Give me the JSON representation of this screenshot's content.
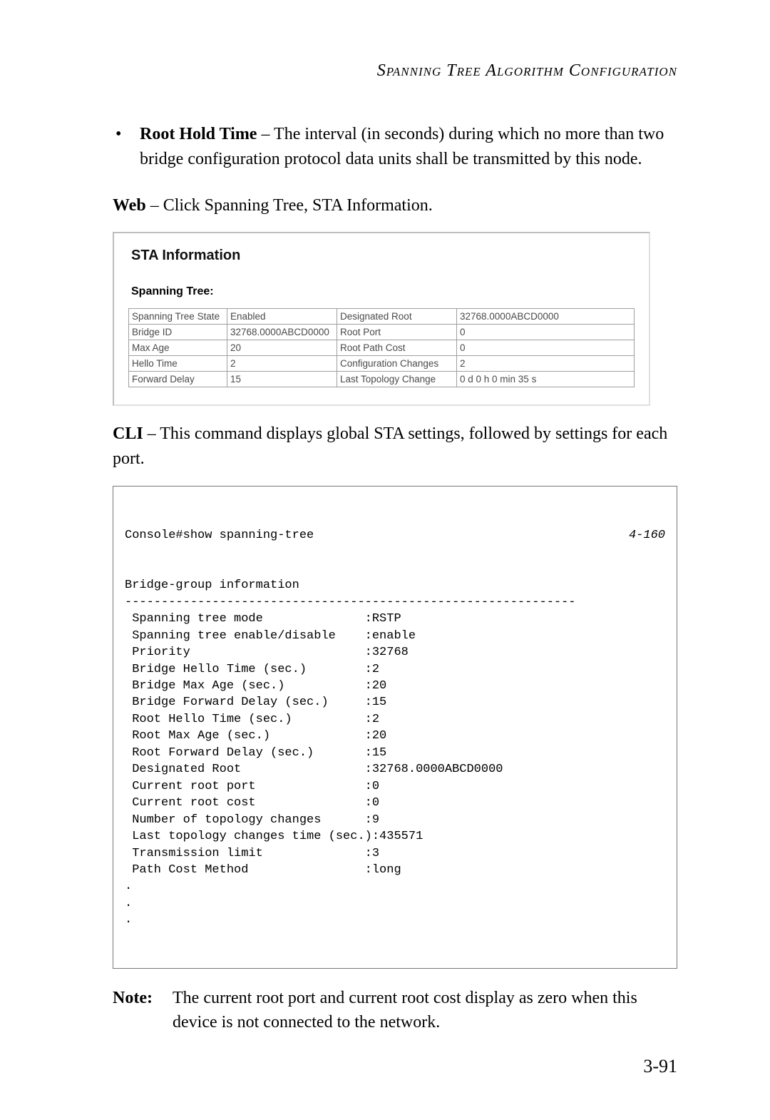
{
  "header": {
    "running_title": "Spanning Tree Algorithm Configuration"
  },
  "bullet": {
    "mark": "•",
    "term": "Root Hold Time",
    "dash": " – ",
    "rest": "The interval (in seconds) during which no more than two bridge configuration protocol data units shall be transmitted by this node."
  },
  "web_line": {
    "label": "Web",
    "dash": " – ",
    "rest": "Click Spanning Tree, STA Information."
  },
  "ui": {
    "title": "STA Information",
    "subtitle": "Spanning Tree:",
    "rows": [
      {
        "a": "Spanning Tree State",
        "b": "Enabled",
        "c": "Designated Root",
        "d": "32768.0000ABCD0000"
      },
      {
        "a": "Bridge ID",
        "b": "32768.0000ABCD0000",
        "c": "Root Port",
        "d": "0"
      },
      {
        "a": "Max Age",
        "b": "20",
        "c": "Root Path Cost",
        "d": "0"
      },
      {
        "a": "Hello Time",
        "b": "2",
        "c": "Configuration Changes",
        "d": "2"
      },
      {
        "a": "Forward Delay",
        "b": "15",
        "c": "Last Topology Change",
        "d": "0 d 0 h 0 min 35 s"
      }
    ]
  },
  "cli_line": {
    "label": "CLI",
    "dash": " – ",
    "rest": "This command displays global STA settings, followed by settings for each port."
  },
  "cli": {
    "command": "Console#show spanning-tree",
    "ref": "4-160",
    "body": "Bridge-group information\n--------------------------------------------------------------\n Spanning tree mode              :RSTP\n Spanning tree enable/disable    :enable\n Priority                        :32768\n Bridge Hello Time (sec.)        :2\n Bridge Max Age (sec.)           :20\n Bridge Forward Delay (sec.)     :15\n Root Hello Time (sec.)          :2\n Root Max Age (sec.)             :20\n Root Forward Delay (sec.)       :15\n Designated Root                 :32768.0000ABCD0000\n Current root port               :0\n Current root cost               :0\n Number of topology changes      :9\n Last topology changes time (sec.):435571\n Transmission limit              :3\n Path Cost Method                :long\n.\n.\n."
  },
  "note": {
    "label": "Note:",
    "text": "The current root port and current root cost display as zero when this device is not connected to the network."
  },
  "page_number": "3-91"
}
